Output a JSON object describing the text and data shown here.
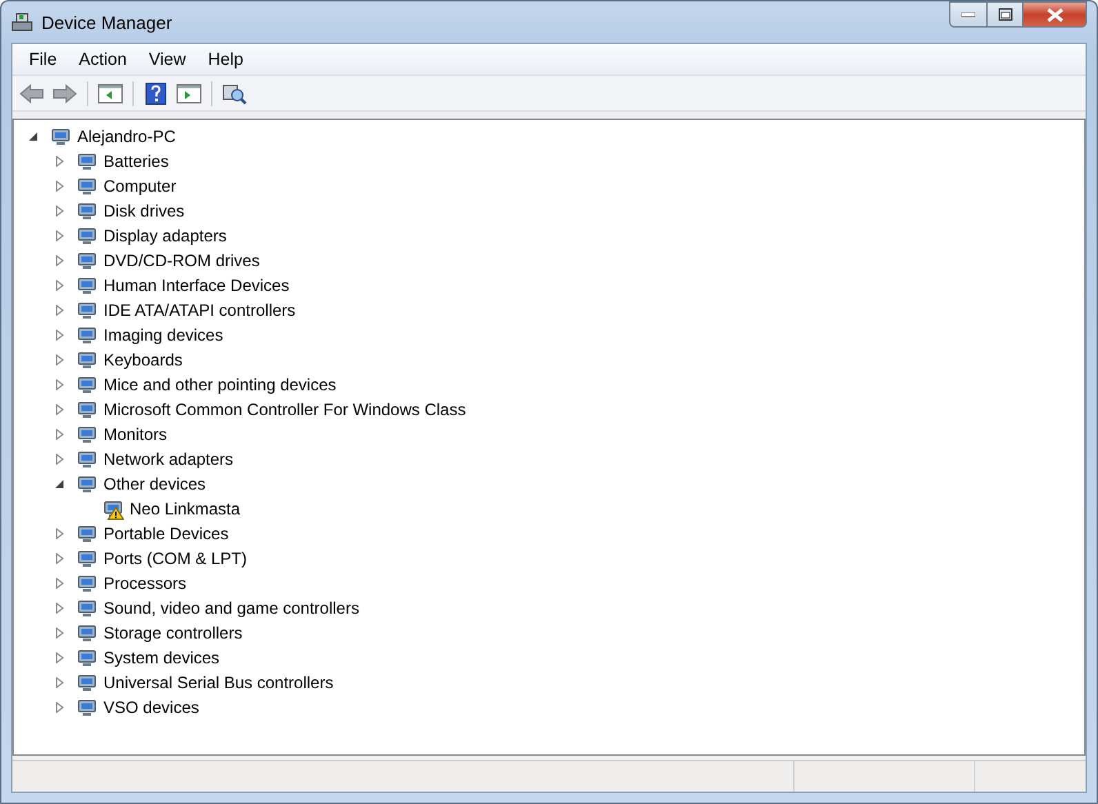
{
  "window": {
    "title": "Device Manager"
  },
  "menu": [
    "File",
    "Action",
    "View",
    "Help"
  ],
  "tree": {
    "label": "Alejandro-PC",
    "expanded": true,
    "children": [
      {
        "label": "Batteries",
        "expanded": false
      },
      {
        "label": "Computer",
        "expanded": false
      },
      {
        "label": "Disk drives",
        "expanded": false
      },
      {
        "label": "Display adapters",
        "expanded": false
      },
      {
        "label": "DVD/CD-ROM drives",
        "expanded": false
      },
      {
        "label": "Human Interface Devices",
        "expanded": false
      },
      {
        "label": "IDE ATA/ATAPI controllers",
        "expanded": false
      },
      {
        "label": "Imaging devices",
        "expanded": false
      },
      {
        "label": "Keyboards",
        "expanded": false
      },
      {
        "label": "Mice and other pointing devices",
        "expanded": false
      },
      {
        "label": "Microsoft Common Controller For Windows Class",
        "expanded": false
      },
      {
        "label": "Monitors",
        "expanded": false
      },
      {
        "label": "Network adapters",
        "expanded": false
      },
      {
        "label": "Other devices",
        "expanded": true,
        "children": [
          {
            "label": "Neo Linkmasta",
            "warning": true
          }
        ]
      },
      {
        "label": "Portable Devices",
        "expanded": false
      },
      {
        "label": "Ports (COM & LPT)",
        "expanded": false
      },
      {
        "label": "Processors",
        "expanded": false
      },
      {
        "label": "Sound, video and game controllers",
        "expanded": false
      },
      {
        "label": "Storage controllers",
        "expanded": false
      },
      {
        "label": "System devices",
        "expanded": false
      },
      {
        "label": "Universal Serial Bus controllers",
        "expanded": false
      },
      {
        "label": "VSO devices",
        "expanded": false
      }
    ]
  }
}
